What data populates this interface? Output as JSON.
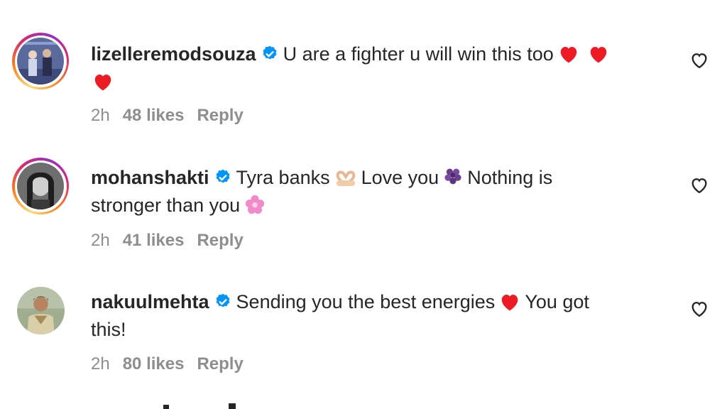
{
  "comments": [
    {
      "username": "lizelleremodsouza",
      "verified": true,
      "text": "U are a fighter u will win this too",
      "emojis": [
        "red-heart",
        "red-heart",
        "red-heart"
      ],
      "time": "2h",
      "likes": "48 likes",
      "reply": "Reply",
      "story_ring": true
    },
    {
      "username": "mohanshakti",
      "verified": true,
      "text_parts": [
        "Tyra banks",
        "Love you",
        "Nothing is",
        "stronger than you"
      ],
      "emojis": [
        "heart-hands",
        "purple-flower",
        "pink-blossom"
      ],
      "time": "2h",
      "likes": "41 likes",
      "reply": "Reply",
      "story_ring": true
    },
    {
      "username": "nakuulmehta",
      "verified": true,
      "text_parts": [
        "Sending you the best energies",
        "You got",
        "this!"
      ],
      "emojis": [
        "red-heart"
      ],
      "time": "2h",
      "likes": "80 likes",
      "reply": "Reply",
      "story_ring": false
    }
  ],
  "colors": {
    "verified": "#0095f6",
    "heart": "#ed1c24",
    "muted_text": "#8e8e8e",
    "ring_start": "#feda75",
    "ring_mid": "#d62976",
    "ring_end": "#962fbf"
  },
  "icons": {
    "like": "heart-outline-icon",
    "verified": "verified-badge-icon"
  }
}
